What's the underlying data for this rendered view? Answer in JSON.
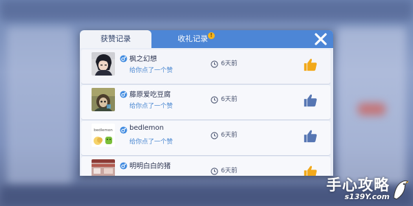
{
  "tabs": [
    {
      "label": "获赞记录",
      "active": true
    },
    {
      "label": "收礼记录",
      "active": false,
      "badge": "!"
    }
  ],
  "close_icon": "close-icon",
  "records": [
    {
      "name": "枫之幻想",
      "message": "给你点了一个赞",
      "time": "6天前",
      "thumb_color": "#f2a91a",
      "gender": "male"
    },
    {
      "name": "藤原爱吃豆腐",
      "message": "给你点了一个赞",
      "time": "6天前",
      "thumb_color": "#5676b3",
      "gender": "male"
    },
    {
      "name": "bedlemon",
      "message": "给你点了一个赞",
      "time": "6天前",
      "thumb_color": "#5676b3",
      "gender": "male",
      "avatar_text": "bedlemon"
    },
    {
      "name": "明明白白的猪",
      "message": "",
      "time": "6天前",
      "thumb_color": "#f2a91a",
      "gender": "male"
    }
  ],
  "watermark": {
    "title": "手心攻略",
    "url": "s139Y.com"
  },
  "colors": {
    "tab_bar": "#4d86d6",
    "accent_blue": "#4e8ad2",
    "thumb_liked": "#f2a91a",
    "thumb_default": "#5676b3"
  }
}
